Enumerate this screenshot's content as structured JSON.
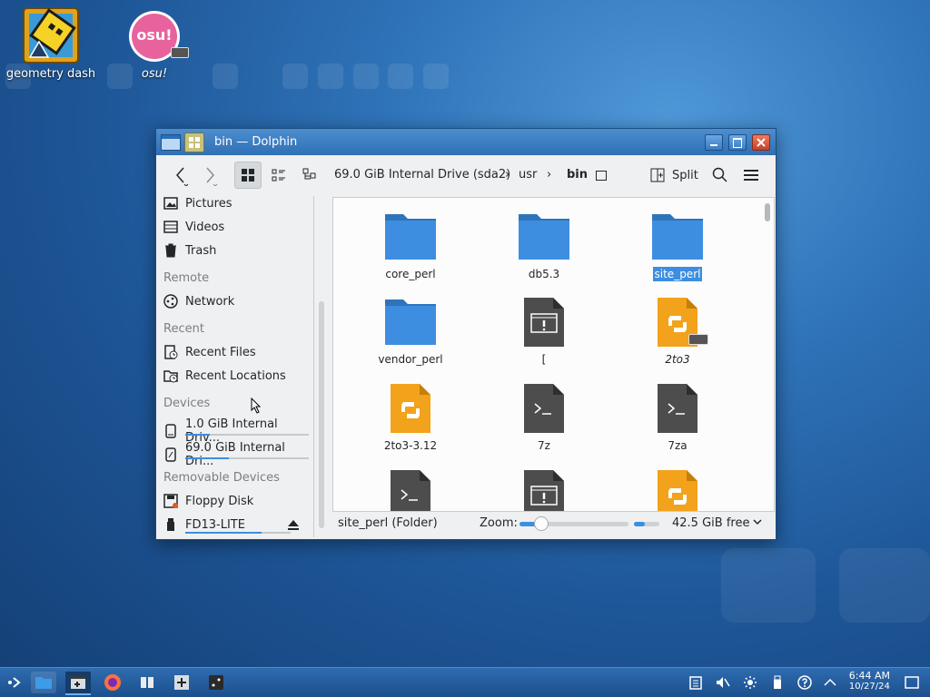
{
  "desktop": {
    "icons": [
      {
        "label": "geometry dash"
      },
      {
        "label": "osu!"
      }
    ],
    "osu_logo_text": "osu!"
  },
  "window": {
    "title": "bin — Dolphin",
    "breadcrumb": {
      "root": "69.0 GiB Internal Drive (sda2)",
      "usr": "usr",
      "bin": "bin"
    },
    "split_label": "Split"
  },
  "sidebar": {
    "places": [
      {
        "label": "Pictures",
        "icon": "pictures-icon"
      },
      {
        "label": "Videos",
        "icon": "videos-icon"
      },
      {
        "label": "Trash",
        "icon": "trash-icon"
      }
    ],
    "remote_header": "Remote",
    "remote": [
      {
        "label": "Network",
        "icon": "network-icon"
      }
    ],
    "recent_header": "Recent",
    "recent": [
      {
        "label": "Recent Files",
        "icon": "recent-files-icon"
      },
      {
        "label": "Recent Locations",
        "icon": "recent-locations-icon"
      }
    ],
    "devices_header": "Devices",
    "devices": [
      {
        "label": "1.0 GiB Internal Driv...",
        "usage": 0.2
      },
      {
        "label": "69.0 GiB Internal Dri...",
        "usage": 0.35
      }
    ],
    "removable_header": "Removable Devices",
    "removable": [
      {
        "label": "Floppy Disk"
      },
      {
        "label": "FD13-LITE",
        "usage": 0.72
      }
    ]
  },
  "files": [
    {
      "name": "core_perl",
      "type": "folder"
    },
    {
      "name": "db5.3",
      "type": "folder"
    },
    {
      "name": "site_perl",
      "type": "folder",
      "selected": true
    },
    {
      "name": "vendor_perl",
      "type": "folder"
    },
    {
      "name": "[",
      "type": "executable"
    },
    {
      "name": "2to3",
      "type": "python",
      "italic": true
    },
    {
      "name": "2to3-3.12",
      "type": "python"
    },
    {
      "name": "7z",
      "type": "script"
    },
    {
      "name": "7za",
      "type": "script"
    }
  ],
  "status": {
    "selection": "site_perl (Folder)",
    "zoom_label": "Zoom:",
    "zoom_level": 0.2,
    "free_space": "42.5 GiB free"
  },
  "taskbar": {
    "time": "6:44 AM",
    "date": "10/27/24"
  },
  "colors": {
    "accent": "#3d8ee0",
    "folder": "#3d8ee0",
    "python": "#f3a21b",
    "script": "#4d4d4d"
  }
}
